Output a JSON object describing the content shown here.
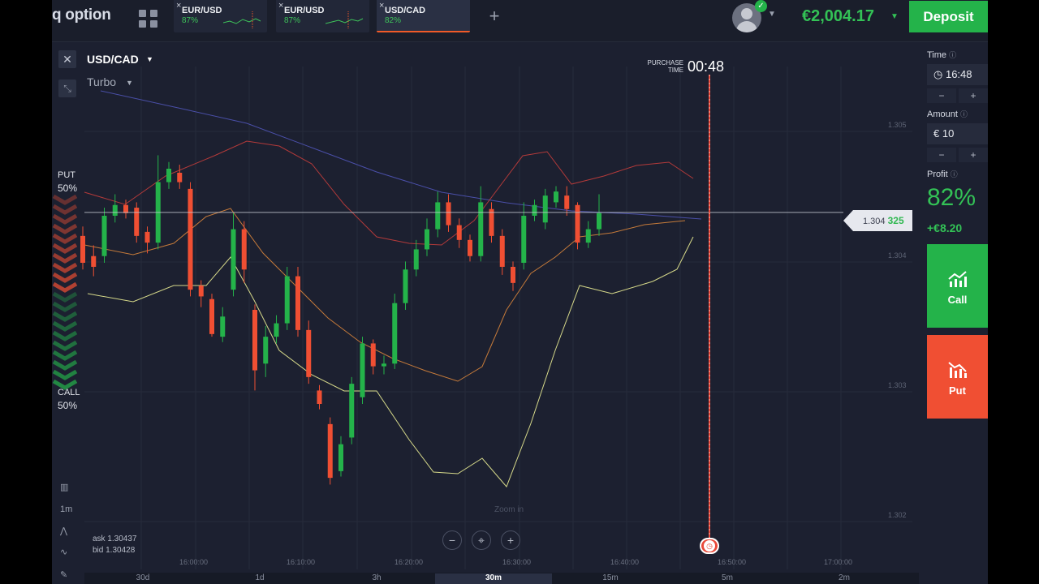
{
  "brand": {
    "logo_text": "q option"
  },
  "tabs": [
    {
      "pair": "EUR/USD",
      "payout": "87%",
      "active": false
    },
    {
      "pair": "EUR/USD",
      "payout": "87%",
      "active": false
    },
    {
      "pair": "USD/CAD",
      "payout": "82%",
      "active": true
    }
  ],
  "header": {
    "balance": "€2,004.17",
    "deposit_label": "Deposit",
    "add_tab_symbol": "+"
  },
  "asset": {
    "name": "USD/CAD",
    "mode": "Turbo"
  },
  "sentiment": {
    "put_label": "PUT",
    "put_pct": "50%",
    "call_label": "CALL",
    "call_pct": "50%"
  },
  "purchase": {
    "label": "PURCHASE TIME",
    "countdown": "00:48"
  },
  "price": {
    "current_prefix": "1.304",
    "current_suffix": "325"
  },
  "y_axis_labels": [
    "1.305",
    "1.304",
    "1.303",
    "1.302"
  ],
  "quotes": {
    "ask": "ask 1.30437",
    "bid": "bid 1.30428"
  },
  "zoom": {
    "hint": "Zoom in",
    "minus": "−",
    "center": "⌖",
    "plus": "+"
  },
  "x_axis_labels": [
    "16:00:00",
    "16:10:00",
    "16:20:00",
    "16:30:00",
    "16:40:00",
    "16:50:00",
    "17:00:00"
  ],
  "tools": [
    "1m"
  ],
  "timeframes": [
    "30d",
    "1d",
    "3h",
    "30m",
    "15m",
    "5m",
    "2m"
  ],
  "active_timeframe": "30m",
  "panel": {
    "time_label": "Time",
    "time_value": "16:48",
    "amount_label": "Amount",
    "amount_value": "€ 10",
    "profit_label": "Profit",
    "profit_pct": "82%",
    "profit_amount": "+€8.20",
    "call_label": "Call",
    "put_label": "Put",
    "minus": "−",
    "plus": "+"
  },
  "colors": {
    "up": "#24b34a",
    "down": "#f04f33",
    "accent": "#f05a28",
    "bg": "#1c2030"
  },
  "icons": [
    "grid-icon",
    "close-icon",
    "collapse-icon",
    "avatar-icon",
    "verified-icon",
    "clock-icon",
    "info-icon",
    "trend-up-icon",
    "trend-down-icon",
    "bar-chart-icon",
    "pencil-icon",
    "line-tool-icon",
    "indicator-icon",
    "timer-icon"
  ],
  "chart_data": {
    "type": "candlestick",
    "ylim": [
      1.30185,
      1.30535
    ],
    "current_price": 1.304325,
    "series": [
      {
        "o": 1.30415,
        "c": 1.30395,
        "h": 1.30422,
        "l": 1.3039
      },
      {
        "o": 1.304,
        "c": 1.30392,
        "h": 1.30408,
        "l": 1.30385
      },
      {
        "o": 1.304,
        "c": 1.3043,
        "h": 1.30436,
        "l": 1.30395
      },
      {
        "o": 1.3043,
        "c": 1.30438,
        "h": 1.30446,
        "l": 1.30425
      },
      {
        "o": 1.30438,
        "c": 1.30432,
        "h": 1.30442,
        "l": 1.30428
      },
      {
        "o": 1.30436,
        "c": 1.30415,
        "h": 1.3044,
        "l": 1.3041
      },
      {
        "o": 1.30418,
        "c": 1.3041,
        "h": 1.30422,
        "l": 1.30402
      },
      {
        "o": 1.3041,
        "c": 1.30455,
        "h": 1.30475,
        "l": 1.30405
      },
      {
        "o": 1.30455,
        "c": 1.30465,
        "h": 1.3047,
        "l": 1.3045
      },
      {
        "o": 1.30462,
        "c": 1.30455,
        "h": 1.30468,
        "l": 1.3045
      },
      {
        "o": 1.3045,
        "c": 1.30375,
        "h": 1.30455,
        "l": 1.3037
      },
      {
        "o": 1.30378,
        "c": 1.3037,
        "h": 1.30382,
        "l": 1.30362
      },
      {
        "o": 1.30368,
        "c": 1.30342,
        "h": 1.30372,
        "l": 1.3034
      },
      {
        "o": 1.3034,
        "c": 1.30355,
        "h": 1.30362,
        "l": 1.30336
      },
      {
        "o": 1.30375,
        "c": 1.3042,
        "h": 1.30432,
        "l": 1.3037
      },
      {
        "o": 1.3042,
        "c": 1.3039,
        "h": 1.30426,
        "l": 1.3038
      },
      {
        "o": 1.3036,
        "c": 1.30315,
        "h": 1.30364,
        "l": 1.303
      },
      {
        "o": 1.3032,
        "c": 1.3034,
        "h": 1.30348,
        "l": 1.3031
      },
      {
        "o": 1.3034,
        "c": 1.3035,
        "h": 1.30356,
        "l": 1.30335
      },
      {
        "o": 1.3035,
        "c": 1.30385,
        "h": 1.30392,
        "l": 1.30345
      },
      {
        "o": 1.30385,
        "c": 1.30345,
        "h": 1.30392,
        "l": 1.3034
      },
      {
        "o": 1.30345,
        "c": 1.3031,
        "h": 1.30352,
        "l": 1.30305
      },
      {
        "o": 1.303,
        "c": 1.3029,
        "h": 1.30304,
        "l": 1.30286
      },
      {
        "o": 1.30275,
        "c": 1.30235,
        "h": 1.3028,
        "l": 1.3023
      },
      {
        "o": 1.3024,
        "c": 1.3026,
        "h": 1.30266,
        "l": 1.30236
      },
      {
        "o": 1.30265,
        "c": 1.30305,
        "h": 1.3031,
        "l": 1.3026
      },
      {
        "o": 1.30295,
        "c": 1.30335,
        "h": 1.3034,
        "l": 1.3029
      },
      {
        "o": 1.30335,
        "c": 1.30318,
        "h": 1.30338,
        "l": 1.30312
      },
      {
        "o": 1.30318,
        "c": 1.3032,
        "h": 1.30326,
        "l": 1.30312
      },
      {
        "o": 1.3032,
        "c": 1.30365,
        "h": 1.30372,
        "l": 1.30316
      },
      {
        "o": 1.30365,
        "c": 1.3039,
        "h": 1.30396,
        "l": 1.3036
      },
      {
        "o": 1.3039,
        "c": 1.30405,
        "h": 1.30412,
        "l": 1.30385
      },
      {
        "o": 1.30405,
        "c": 1.3042,
        "h": 1.30428,
        "l": 1.304
      },
      {
        "o": 1.3042,
        "c": 1.3044,
        "h": 1.30448,
        "l": 1.30414
      },
      {
        "o": 1.3044,
        "c": 1.30423,
        "h": 1.30446,
        "l": 1.30418
      },
      {
        "o": 1.30423,
        "c": 1.30412,
        "h": 1.30428,
        "l": 1.30406
      },
      {
        "o": 1.30412,
        "c": 1.304,
        "h": 1.30416,
        "l": 1.30396
      },
      {
        "o": 1.304,
        "c": 1.3044,
        "h": 1.30452,
        "l": 1.30396
      },
      {
        "o": 1.30435,
        "c": 1.30415,
        "h": 1.3044,
        "l": 1.3041
      },
      {
        "o": 1.30415,
        "c": 1.30392,
        "h": 1.3042,
        "l": 1.30386
      },
      {
        "o": 1.30392,
        "c": 1.3038,
        "h": 1.30396,
        "l": 1.30374
      },
      {
        "o": 1.30395,
        "c": 1.3043,
        "h": 1.3044,
        "l": 1.3039
      },
      {
        "o": 1.3043,
        "c": 1.30438,
        "h": 1.30442,
        "l": 1.30426
      },
      {
        "o": 1.30425,
        "c": 1.30445,
        "h": 1.3045,
        "l": 1.3042
      },
      {
        "o": 1.3044,
        "c": 1.30448,
        "h": 1.30452,
        "l": 1.30436
      },
      {
        "o": 1.30445,
        "c": 1.30435,
        "h": 1.30452,
        "l": 1.3043
      },
      {
        "o": 1.30438,
        "c": 1.3041,
        "h": 1.3044,
        "l": 1.30405
      },
      {
        "o": 1.3041,
        "c": 1.3042,
        "h": 1.30426,
        "l": 1.30406
      },
      {
        "o": 1.3042,
        "c": 1.30432,
        "h": 1.30446,
        "l": 1.30415
      }
    ]
  }
}
